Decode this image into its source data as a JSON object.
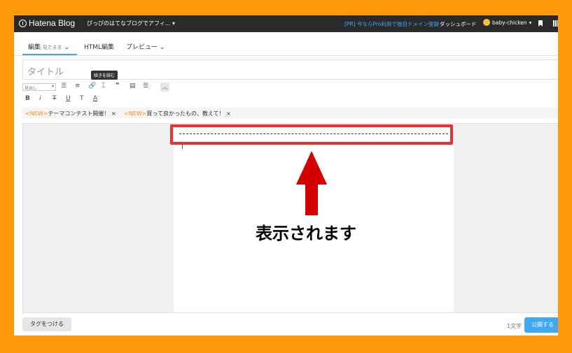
{
  "topbar": {
    "logo": "Hatena Blog",
    "blog_name": "ぴっぴのはてなブログでアフィ...",
    "pr_link": "[PR] 今ならPro利用で独自ドメイン登録",
    "dashboard": "ダッシュボード",
    "username": "baby-chicken",
    "caret": "▾"
  },
  "tabs": {
    "edit": "編集",
    "edit_sub": "見たまま",
    "html": "HTML編集",
    "preview": "プレビュー"
  },
  "title": {
    "placeholder": "タイトル"
  },
  "toolbar": {
    "format_select": "見出し",
    "tooltip": "続きを読む",
    "bold": "B",
    "italic": "i",
    "strike": "T",
    "underline": "U",
    "size": "T",
    "color": "A"
  },
  "notices": [
    {
      "badge": "<NEW>",
      "text": "テーマコンテスト開催！",
      "close": "×"
    },
    {
      "badge": "<NEW>",
      "text": "買って良かったもの、教えて！",
      "close": "×"
    }
  ],
  "annotation": {
    "caption": "表示されます"
  },
  "footer": {
    "tag_button": "タグをつける",
    "char_count": "1文字",
    "publish_button": "公開する"
  }
}
